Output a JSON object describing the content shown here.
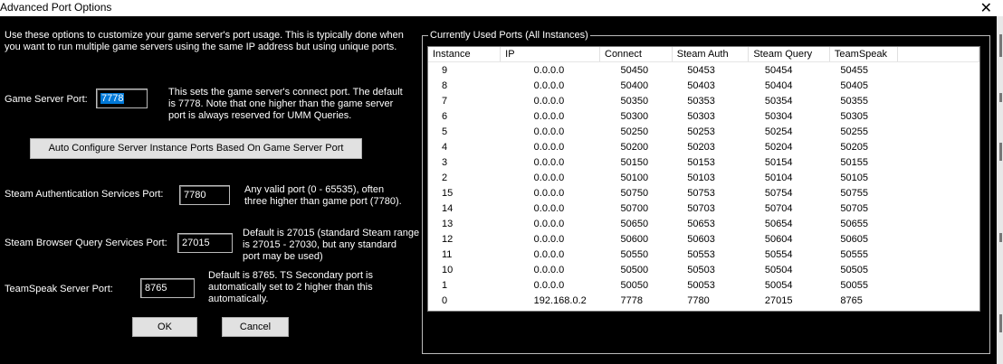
{
  "window": {
    "title": "Advanced Port Options",
    "close_glyph": "✕"
  },
  "intro_text": "Use these options to customize your game server's port usage.  This is typically done when\nyou want to run multiple game servers using the same IP address but using unique ports.",
  "game_port": {
    "label": "Game Server Port:",
    "value": "7778",
    "help": "This sets the game server's connect port.  The default\nis 7778.  Note that one higher than the game server\nport is always reserved for UMM Queries."
  },
  "auto_configure_label": "Auto Configure Server Instance Ports Based On Game Server Port",
  "steam_auth": {
    "label": "Steam Authentication Services Port:",
    "value": "7780",
    "help": "Any valid port (0 - 65535), often\nthree higher than game port (7780)."
  },
  "steam_query": {
    "label": "Steam Browser Query Services Port:",
    "value": "27015",
    "help": "Default is 27015 (standard Steam range\nis 27015 - 27030, but any standard\nport may be used)"
  },
  "teamspeak": {
    "label": "TeamSpeak Server Port:",
    "value": "8765",
    "help": "Default is 8765.  TS Secondary port is\nautomatically set to 2 higher than this\nautomatically."
  },
  "ok_label": "OK",
  "cancel_label": "Cancel",
  "ports_group": {
    "title": "Currently Used Ports (All Instances)",
    "columns": [
      "Instance",
      "IP",
      "Connect",
      "Steam Auth",
      "Steam Query",
      "TeamSpeak"
    ],
    "rows": [
      [
        "9",
        "0.0.0.0",
        "50450",
        "50453",
        "50454",
        "50455"
      ],
      [
        "8",
        "0.0.0.0",
        "50400",
        "50403",
        "50404",
        "50405"
      ],
      [
        "7",
        "0.0.0.0",
        "50350",
        "50353",
        "50354",
        "50355"
      ],
      [
        "6",
        "0.0.0.0",
        "50300",
        "50303",
        "50304",
        "50305"
      ],
      [
        "5",
        "0.0.0.0",
        "50250",
        "50253",
        "50254",
        "50255"
      ],
      [
        "4",
        "0.0.0.0",
        "50200",
        "50203",
        "50204",
        "50205"
      ],
      [
        "3",
        "0.0.0.0",
        "50150",
        "50153",
        "50154",
        "50155"
      ],
      [
        "2",
        "0.0.0.0",
        "50100",
        "50103",
        "50104",
        "50105"
      ],
      [
        "15",
        "0.0.0.0",
        "50750",
        "50753",
        "50754",
        "50755"
      ],
      [
        "14",
        "0.0.0.0",
        "50700",
        "50703",
        "50704",
        "50705"
      ],
      [
        "13",
        "0.0.0.0",
        "50650",
        "50653",
        "50654",
        "50655"
      ],
      [
        "12",
        "0.0.0.0",
        "50600",
        "50603",
        "50604",
        "50605"
      ],
      [
        "11",
        "0.0.0.0",
        "50550",
        "50553",
        "50554",
        "50555"
      ],
      [
        "10",
        "0.0.0.0",
        "50500",
        "50503",
        "50504",
        "50505"
      ],
      [
        "1",
        "0.0.0.0",
        "50050",
        "50053",
        "50054",
        "50055"
      ],
      [
        "0",
        "192.168.0.2",
        "7778",
        "7780",
        "27015",
        "8765"
      ]
    ]
  }
}
